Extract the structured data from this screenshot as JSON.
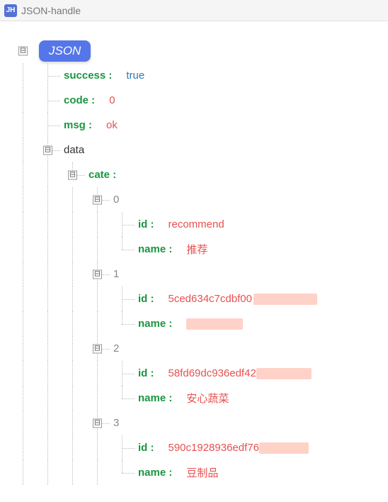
{
  "titlebar": {
    "logo": "JH",
    "title": "JSON-handle"
  },
  "root": {
    "badge": "JSON"
  },
  "nodes": {
    "success": {
      "key": "success :",
      "value": "true"
    },
    "code": {
      "key": "code :",
      "value": "0"
    },
    "msg": {
      "key": "msg :",
      "value": "ok"
    },
    "data": {
      "key": "data"
    },
    "cate": {
      "key": "cate :"
    },
    "idx0": {
      "label": "0"
    },
    "idx1": {
      "label": "1"
    },
    "idx2": {
      "label": "2"
    },
    "idx3": {
      "label": "3"
    },
    "item0": {
      "id_key": "id :",
      "id_val": "recommend",
      "name_key": "name :",
      "name_val": "推荐"
    },
    "item1": {
      "id_key": "id :",
      "id_val": "5ced634c7cdbf00",
      "name_key": "name :",
      "name_val": ""
    },
    "item2": {
      "id_key": "id :",
      "id_val": "58fd69dc936edf42",
      "name_key": "name :",
      "name_val": "安心蔬菜"
    },
    "item3": {
      "id_key": "id :",
      "id_val": "590c1928936edf76",
      "name_key": "name :",
      "name_val": "豆制品"
    }
  },
  "toggle": {
    "minus": "⊟"
  }
}
